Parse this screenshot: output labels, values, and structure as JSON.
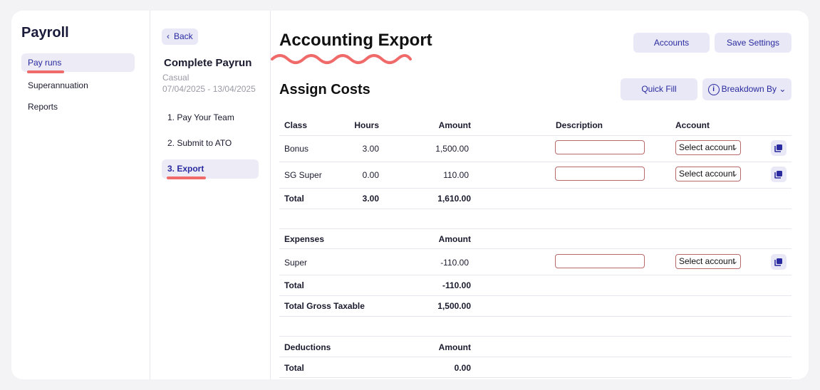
{
  "app": {
    "title": "Payroll"
  },
  "nav": {
    "items": [
      {
        "label": "Pay runs",
        "active": true
      },
      {
        "label": "Superannuation"
      },
      {
        "label": "Reports"
      }
    ]
  },
  "steps_panel": {
    "back_label": "Back",
    "title": "Complete Payrun",
    "type": "Casual",
    "dates": "07/04/2025 - 13/04/2025",
    "steps": [
      {
        "label": "1. Pay Your Team"
      },
      {
        "label": "2. Submit to ATO"
      },
      {
        "label": "3. Export",
        "active": true
      }
    ]
  },
  "main": {
    "title": "Accounting Export",
    "accounts_button": "Accounts",
    "save_settings_button": "Save Settings",
    "section_title": "Assign Costs",
    "quick_fill_button": "Quick Fill",
    "breakdown_button": "Breakdown By",
    "account_placeholder": "Select account",
    "costs": {
      "headers": {
        "class": "Class",
        "hours": "Hours",
        "amount": "Amount",
        "description": "Description",
        "account": "Account"
      },
      "rows": [
        {
          "class": "Bonus",
          "hours": "3.00",
          "amount": "1,500.00"
        },
        {
          "class": "SG Super",
          "hours": "0.00",
          "amount": "110.00"
        }
      ],
      "total": {
        "label": "Total",
        "hours": "3.00",
        "amount": "1,610.00"
      }
    },
    "expenses": {
      "headers": {
        "class": "Expenses",
        "amount": "Amount"
      },
      "rows": [
        {
          "class": "Super",
          "amount": "-110.00"
        }
      ],
      "total": {
        "label": "Total",
        "amount": "-110.00"
      },
      "gross": {
        "label": "Total Gross Taxable",
        "amount": "1,500.00"
      }
    },
    "deductions": {
      "headers": {
        "class": "Deductions",
        "amount": "Amount"
      },
      "total": {
        "label": "Total",
        "amount": "0.00"
      }
    }
  },
  "colors": {
    "accent": "#2a2aa0",
    "highlight": "#f06a6a",
    "active_bg": "#ecebf6"
  }
}
